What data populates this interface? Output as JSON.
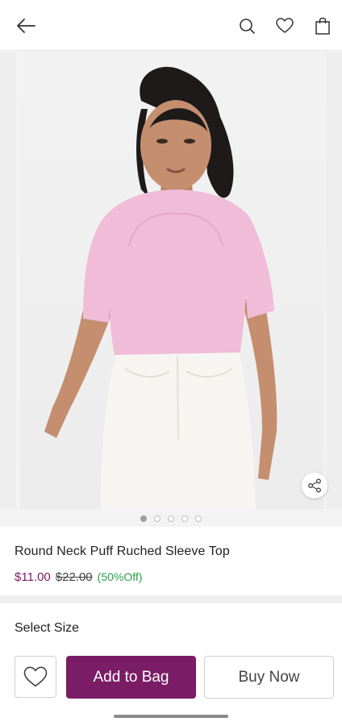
{
  "header": {
    "back_icon": "arrow-left-icon",
    "search_icon": "search-icon",
    "wishlist_icon": "heart-icon",
    "bag_icon": "shopping-bag-icon"
  },
  "gallery": {
    "image_count": 5,
    "active_index": 0,
    "share_icon": "share-icon"
  },
  "product": {
    "title": "Round Neck Puff Ruched Sleeve Top",
    "price": "$11.00",
    "original_price": "$22.00",
    "discount": "(50%Off)"
  },
  "size": {
    "label": "Select Size"
  },
  "actions": {
    "wishlist_icon": "heart-icon",
    "add_to_bag": "Add to Bag",
    "buy_now": "Buy Now"
  },
  "colors": {
    "brand": "#7b1c66",
    "price": "#7d1a6a",
    "discount": "#2e9e4a",
    "top_pink": "#f0bcd8",
    "jeans_white": "#f7f5f2"
  }
}
